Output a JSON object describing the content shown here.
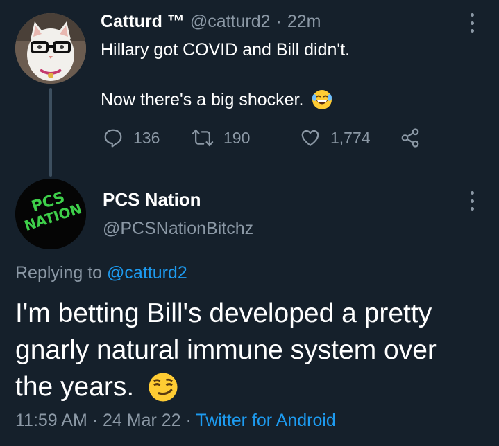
{
  "parent_tweet": {
    "name": "Catturd ™",
    "handle": "@catturd2",
    "separator": "·",
    "time": "22m",
    "text_line1": "Hillary got COVID and Bill didn't.",
    "text_line2": "Now there's a big shocker.",
    "emoji": "grinning-sweat-laugh-emoji",
    "replies": "136",
    "retweets": "190",
    "likes": "1,774",
    "avatar_icon": "cat-with-glasses-avatar"
  },
  "reply_tweet": {
    "name": "PCS Nation",
    "handle": "@PCSNationBitchz",
    "avatar_text_top": "PCS",
    "avatar_text_bottom": "NATION",
    "replying_label": "Replying to",
    "replying_to": "@catturd2",
    "body_line1": "I'm betting Bill's developed a pretty",
    "body_line2": "gnarly natural immune system over",
    "body_line3": "the years.",
    "emoji": "smirking-face-emoji",
    "time": "11:59 AM",
    "sep1": "·",
    "date": "24 Mar 22",
    "sep2": "·",
    "source": "Twitter for Android"
  },
  "colors": {
    "background": "#15202b",
    "text": "#ffffff",
    "muted": "#8b98a5",
    "link": "#1d9bf0",
    "thread_line": "#3d4f5f",
    "avatar_text": "#3ecf4a"
  }
}
